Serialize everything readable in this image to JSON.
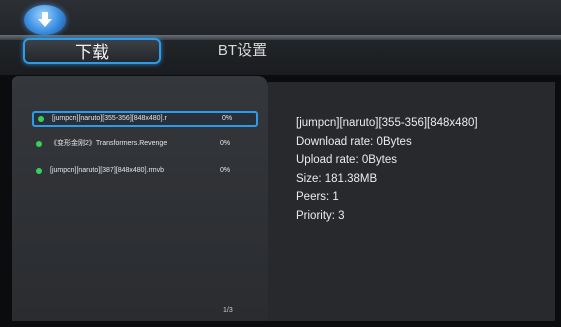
{
  "tabs": [
    {
      "label": "下载",
      "active": true
    },
    {
      "label": "BT设置",
      "active": false
    }
  ],
  "icons": {
    "logo": "download-arrow-icon"
  },
  "colors": {
    "accent": "#2e9be8",
    "status_dot": "#39d05a"
  },
  "downloads": [
    {
      "name": "[jumpcn][naruto][355-356][848x480].r",
      "percent": "0%",
      "selected": true
    },
    {
      "name": "《变形金刚2》Transformers.Revenge",
      "percent": "0%",
      "selected": false
    },
    {
      "name": "[jumpcn][naruto][387][848x480].rmvb",
      "percent": "0%",
      "selected": false
    }
  ],
  "pager": "1/3",
  "details": {
    "filename": "[jumpcn][naruto][355-356][848x480]",
    "download_rate": "Download rate: 0Bytes",
    "upload_rate": "Upload rate: 0Bytes",
    "size": "Size: 181.38MB",
    "peers": "Peers: 1",
    "priority": "Priority: 3"
  }
}
